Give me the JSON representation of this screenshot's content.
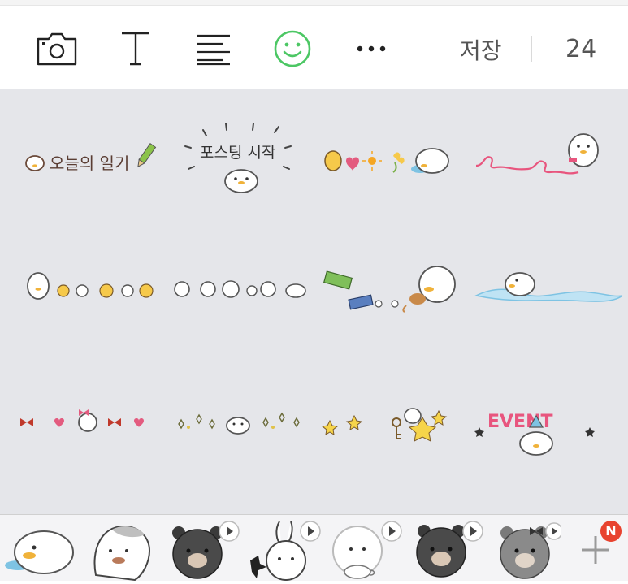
{
  "toolbar": {
    "icons": [
      "camera-icon",
      "text-icon",
      "align-icon",
      "emoji-icon",
      "more-icon"
    ],
    "save_label": "저장",
    "count": "24",
    "accent_color": "#4cc764"
  },
  "stickers": [
    {
      "text": "오늘의 일기"
    },
    {
      "text": "포스팅 시작"
    },
    {
      "text": ""
    },
    {
      "text": ""
    },
    {
      "text": ""
    },
    {
      "text": ""
    },
    {
      "text": ""
    },
    {
      "text": ""
    },
    {
      "text": ""
    },
    {
      "text": ""
    },
    {
      "text": ""
    },
    {
      "text": "EVENT"
    }
  ],
  "tray": {
    "items": [
      "duck-sticker-pack",
      "bear-face-pack",
      "brown-pack",
      "cony-pack",
      "sally-pack",
      "brown-pack-2",
      "choco-pack"
    ],
    "add_badge": "N"
  }
}
